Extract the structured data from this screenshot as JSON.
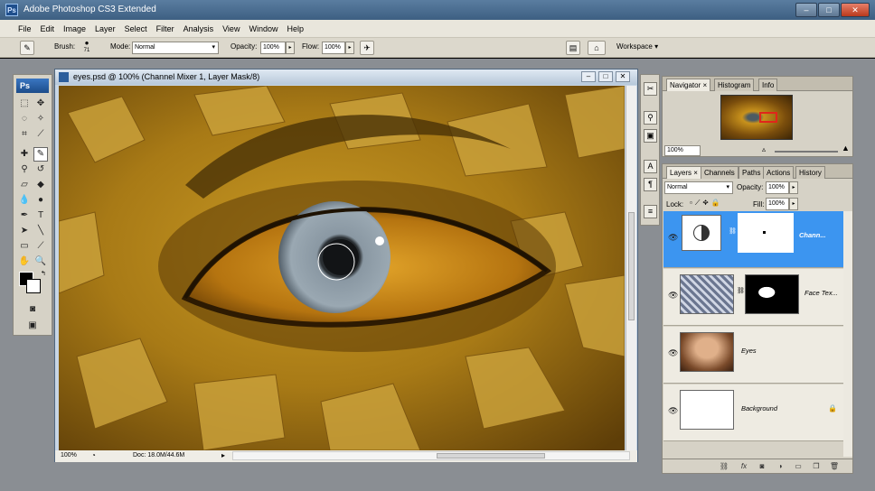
{
  "app": {
    "title": "Adobe Photoshop CS3 Extended",
    "logo": "Ps"
  },
  "window_controls": {
    "minimize": "–",
    "maximize": "□",
    "close": "✕"
  },
  "menu": [
    "File",
    "Edit",
    "Image",
    "Layer",
    "Select",
    "Filter",
    "Analysis",
    "View",
    "Window",
    "Help"
  ],
  "options": {
    "brush_label": "Brush:",
    "brush_size": "71",
    "mode_label": "Mode:",
    "mode_value": "Normal",
    "opacity_label": "Opacity:",
    "opacity_value": "100%",
    "flow_label": "Flow:",
    "flow_value": "100%",
    "workspace_label": "Workspace ▾"
  },
  "document": {
    "title": "eyes.psd @ 100% (Channel Mixer 1, Layer Mask/8)",
    "zoom": "100%",
    "doc_size": "Doc: 18.0M/44.6M"
  },
  "navigator": {
    "tabs": [
      "Navigator ×",
      "Histogram",
      "Info"
    ],
    "zoom": "100%"
  },
  "layers_panel": {
    "tabs": [
      "Layers ×",
      "Channels",
      "Paths",
      "Actions",
      "History"
    ],
    "blend_mode": "Normal",
    "opacity_label": "Opacity:",
    "opacity_value": "100%",
    "lock_label": "Lock:",
    "fill_label": "Fill:",
    "fill_value": "100%",
    "layers": [
      {
        "name": "Chann...",
        "selected": true
      },
      {
        "name": "Face Tex...",
        "selected": false
      },
      {
        "name": "Eyes",
        "selected": false
      },
      {
        "name": "Background",
        "selected": false
      }
    ],
    "bottom_icons": [
      "link-icon",
      "fx-icon",
      "mask-icon",
      "adjustment-icon",
      "group-icon",
      "new-layer-icon",
      "trash-icon"
    ]
  },
  "colors": {
    "accent": "#3c95f0",
    "titlebar": "#4a6e92",
    "workspace": "#8a8e93",
    "image_gold": "#a77b15"
  }
}
